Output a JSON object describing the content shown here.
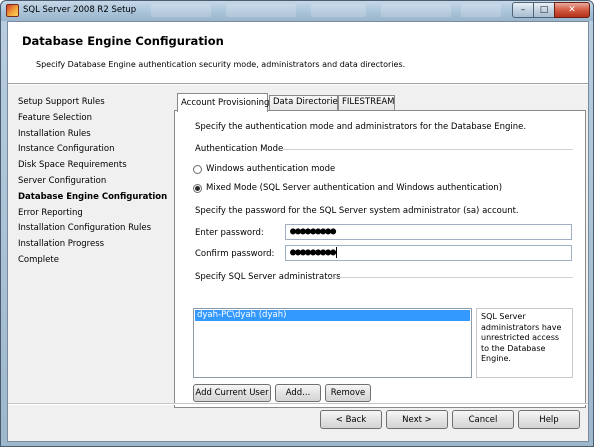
{
  "window": {
    "title": "SQL Server 2008 R2 Setup",
    "controls": {
      "minimize": "–",
      "maximize": "□",
      "close": "✕"
    }
  },
  "header": {
    "title": "Database Engine Configuration",
    "subtitle": "Specify Database Engine authentication security mode, administrators and data directories."
  },
  "nav": {
    "items": [
      {
        "label": "Setup Support Rules",
        "current": false
      },
      {
        "label": "Feature Selection",
        "current": false
      },
      {
        "label": "Installation Rules",
        "current": false
      },
      {
        "label": "Instance Configuration",
        "current": false
      },
      {
        "label": "Disk Space Requirements",
        "current": false
      },
      {
        "label": "Server Configuration",
        "current": false
      },
      {
        "label": "Database Engine Configuration",
        "current": true
      },
      {
        "label": "Error Reporting",
        "current": false
      },
      {
        "label": "Installation Configuration Rules",
        "current": false
      },
      {
        "label": "Installation Progress",
        "current": false
      },
      {
        "label": "Complete",
        "current": false
      }
    ]
  },
  "tabs": [
    {
      "label": "Account Provisioning",
      "active": true
    },
    {
      "label": "Data Directories",
      "active": false
    },
    {
      "label": "FILESTREAM",
      "active": false
    }
  ],
  "account": {
    "intro": "Specify the authentication mode and administrators for the Database Engine.",
    "auth_mode_label": "Authentication Mode",
    "windows_auth_label": "Windows authentication mode",
    "mixed_mode_label": "Mixed Mode (SQL Server authentication and Windows authentication)",
    "selected_mode": "mixed",
    "sa_password_prompt": "Specify the password for the SQL Server system administrator (sa) account.",
    "enter_password_label": "Enter password:",
    "enter_password_value": "●●●●●●●●●",
    "confirm_password_label": "Confirm password:",
    "confirm_password_value": "●●●●●●●●●",
    "admins_label": "Specify SQL Server administrators",
    "admins": [
      "dyah-PC\\dyah (dyah)"
    ],
    "admins_note": "SQL Server administrators have unrestricted access to the Database Engine.",
    "add_current_user_label": "Add Current User",
    "add_label": "Add...",
    "remove_label": "Remove"
  },
  "footer": {
    "back_label": "< Back",
    "next_label": "Next >",
    "cancel_label": "Cancel",
    "help_label": "Help"
  }
}
